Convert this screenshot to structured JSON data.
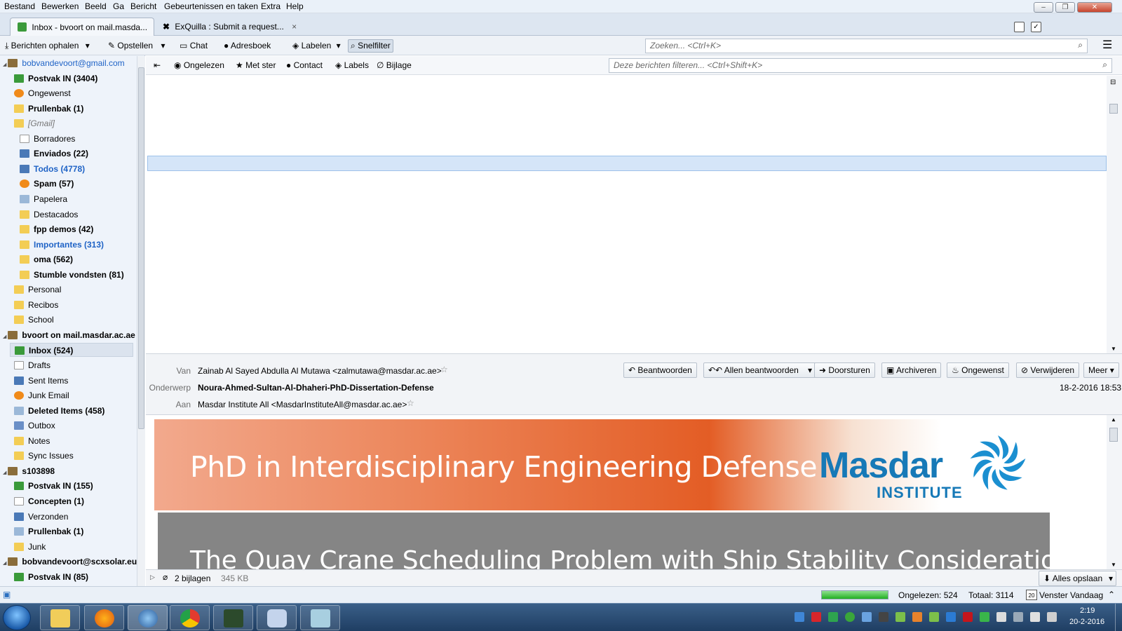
{
  "menu": [
    "Bestand",
    "Bewerken",
    "Beeld",
    "Ga",
    "Bericht",
    "Gebeurtenissen en taken",
    "Extra",
    "Help"
  ],
  "tabs": [
    {
      "label": "Inbox - bvoort on mail.masda..."
    },
    {
      "label": "ExQuilla : Submit a request..."
    }
  ],
  "toolbar": {
    "get_messages": "Berichten ophalen",
    "compose": "Opstellen",
    "chat": "Chat",
    "address_book": "Adresboek",
    "tag": "Labelen",
    "quick_filter": "Snelfilter",
    "search_placeholder": "Zoeken... <Ctrl+K>"
  },
  "filterbar": {
    "unread": "Ongelezen",
    "starred": "Met ster",
    "contact": "Contact",
    "tags": "Labels",
    "attachment": "Bijlage",
    "filter_placeholder": "Deze berichten filteren... <Ctrl+Shift+K>"
  },
  "folders": [
    {
      "label": "bobvandevoort@gmail.com",
      "level": 0,
      "style": "account-blue"
    },
    {
      "label": "Postvak IN (3404)",
      "level": 1,
      "style": "bold",
      "icon": "inbox"
    },
    {
      "label": "Ongewenst",
      "level": 1,
      "style": "normal",
      "icon": "junk"
    },
    {
      "label": "Prullenbak (1)",
      "level": 1,
      "style": "bold",
      "icon": "folder"
    },
    {
      "label": "[Gmail]",
      "level": 1,
      "style": "gray",
      "icon": "folder"
    },
    {
      "label": "Borradores",
      "level": 2,
      "style": "normal",
      "icon": "doc"
    },
    {
      "label": "Enviados (22)",
      "level": 2,
      "style": "bold",
      "icon": "sent"
    },
    {
      "label": "Todos (4778)",
      "level": 2,
      "style": "bold-blue",
      "icon": "archive"
    },
    {
      "label": "Spam (57)",
      "level": 2,
      "style": "bold",
      "icon": "junk"
    },
    {
      "label": "Papelera",
      "level": 2,
      "style": "normal",
      "icon": "trash"
    },
    {
      "label": "Destacados",
      "level": 2,
      "style": "normal",
      "icon": "folder"
    },
    {
      "label": "fpp demos (42)",
      "level": 2,
      "style": "bold",
      "icon": "folder"
    },
    {
      "label": "Importantes (313)",
      "level": 2,
      "style": "bold-blue",
      "icon": "folder"
    },
    {
      "label": "oma (562)",
      "level": 2,
      "style": "bold",
      "icon": "folder"
    },
    {
      "label": "Stumble vondsten (81)",
      "level": 2,
      "style": "bold",
      "icon": "folder"
    },
    {
      "label": "Personal",
      "level": 1,
      "style": "normal",
      "icon": "folder"
    },
    {
      "label": "Recibos",
      "level": 1,
      "style": "normal",
      "icon": "folder"
    },
    {
      "label": "School",
      "level": 1,
      "style": "normal",
      "icon": "folder"
    },
    {
      "label": "bvoort on mail.masdar.ac.ae",
      "level": 0,
      "style": "account-bold"
    },
    {
      "label": "Inbox (524)",
      "level": 1,
      "style": "bold",
      "icon": "inbox",
      "selected": true
    },
    {
      "label": "Drafts",
      "level": 1,
      "style": "normal",
      "icon": "doc"
    },
    {
      "label": "Sent Items",
      "level": 1,
      "style": "normal",
      "icon": "sent"
    },
    {
      "label": "Junk Email",
      "level": 1,
      "style": "normal",
      "icon": "junk"
    },
    {
      "label": "Deleted Items (458)",
      "level": 1,
      "style": "bold",
      "icon": "trash"
    },
    {
      "label": "Outbox",
      "level": 1,
      "style": "normal",
      "icon": "outbox"
    },
    {
      "label": "Notes",
      "level": 1,
      "style": "normal",
      "icon": "folder"
    },
    {
      "label": "Sync Issues",
      "level": 1,
      "style": "normal",
      "icon": "folder"
    },
    {
      "label": "s103898",
      "level": 0,
      "style": "account-bold"
    },
    {
      "label": "Postvak IN (155)",
      "level": 1,
      "style": "bold",
      "icon": "inbox"
    },
    {
      "label": "Concepten (1)",
      "level": 1,
      "style": "bold",
      "icon": "doc"
    },
    {
      "label": "Verzonden",
      "level": 1,
      "style": "normal",
      "icon": "sent"
    },
    {
      "label": "Prullenbak (1)",
      "level": 1,
      "style": "bold",
      "icon": "trash"
    },
    {
      "label": "Junk",
      "level": 1,
      "style": "normal",
      "icon": "folder"
    },
    {
      "label": "bobvandevoort@scxsolar.eu",
      "level": 0,
      "style": "account-bold"
    },
    {
      "label": "Postvak IN (85)",
      "level": 1,
      "style": "bold",
      "icon": "inbox"
    }
  ],
  "message": {
    "from_label": "Van",
    "from": "Zainab Al Sayed Abdulla Al Mutawa <zalmutawa@masdar.ac.ae>",
    "subject_label": "Onderwerp",
    "subject": "Noura-Ahmed-Sultan-Al-Dhaheri-PhD-Dissertation-Defense",
    "to_label": "Aan",
    "to": "Masdar Institute All <MasdarInstituteAll@masdar.ac.ae>",
    "date": "18-2-2016 18:53"
  },
  "actions": {
    "reply": "Beantwoorden",
    "reply_all": "Allen beantwoorden",
    "forward": "Doorsturen",
    "archive": "Archiveren",
    "junk": "Ongewenst",
    "delete": "Verwijderen",
    "more": "Meer"
  },
  "body": {
    "banner_title": "PhD in Interdisciplinary Engineering Defense",
    "logo_word": "Masdar",
    "logo_sub": "INSTITUTE",
    "thesis_title": "The Quay Crane Scheduling Problem with Ship Stability Consideration: Formula-"
  },
  "attachments": {
    "count": "2 bijlagen",
    "size": "345 KB",
    "save_all": "Alles opslaan"
  },
  "status": {
    "unread": "Ongelezen: 524",
    "total": "Totaal: 3114",
    "today_pane": "Venster Vandaag",
    "calendar_day": "20",
    "progress": 1.0
  },
  "clock": {
    "time": "2:19",
    "date": "20-2-2016"
  },
  "colors": {
    "accent": "#1f63c6",
    "banner_orange": "#e35d25",
    "logo_blue": "#1679b7",
    "selection": "#d5e5f8"
  }
}
